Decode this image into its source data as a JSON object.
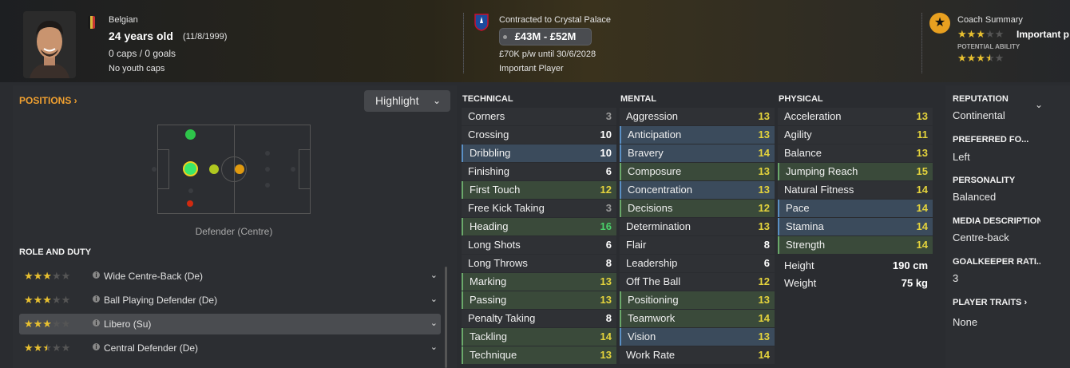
{
  "header": {
    "nationality": "Belgian",
    "age": "24 years old",
    "dob": "(11/8/1999)",
    "caps": "0 caps / 0 goals",
    "youth": "No youth caps",
    "contract": "Contracted to Crystal Palace",
    "value": "£43M - £52M",
    "wage": "£70K p/w until 30/6/2028",
    "status": "Important Player",
    "coach_label": "Coach Summary",
    "coach_rating": "Important p",
    "potential_label": "POTENTIAL ABILITY",
    "current_stars": 3,
    "potential_stars": 3.5
  },
  "positions": {
    "link": "POSITIONS ›",
    "highlight": "Highlight",
    "caption": "Defender (Centre)"
  },
  "role_duty": {
    "title": "ROLE AND DUTY",
    "roles": [
      {
        "name": "Wide Centre-Back (De)",
        "stars": 3
      },
      {
        "name": "Ball Playing Defender (De)",
        "stars": 3
      },
      {
        "name": "Libero (Su)",
        "stars": 3
      },
      {
        "name": "Central Defender (De)",
        "stars": 2.5
      }
    ]
  },
  "technical": {
    "title": "TECHNICAL",
    "items": [
      {
        "name": "Corners",
        "value": "3"
      },
      {
        "name": "Crossing",
        "value": "10"
      },
      {
        "name": "Dribbling",
        "value": "10"
      },
      {
        "name": "Finishing",
        "value": "6"
      },
      {
        "name": "First Touch",
        "value": "12"
      },
      {
        "name": "Free Kick Taking",
        "value": "3"
      },
      {
        "name": "Heading",
        "value": "16"
      },
      {
        "name": "Long Shots",
        "value": "6"
      },
      {
        "name": "Long Throws",
        "value": "8"
      },
      {
        "name": "Marking",
        "value": "13"
      },
      {
        "name": "Passing",
        "value": "13"
      },
      {
        "name": "Penalty Taking",
        "value": "8"
      },
      {
        "name": "Tackling",
        "value": "14"
      },
      {
        "name": "Technique",
        "value": "13"
      }
    ]
  },
  "mental": {
    "title": "MENTAL",
    "items": [
      {
        "name": "Aggression",
        "value": "13"
      },
      {
        "name": "Anticipation",
        "value": "13"
      },
      {
        "name": "Bravery",
        "value": "14"
      },
      {
        "name": "Composure",
        "value": "13"
      },
      {
        "name": "Concentration",
        "value": "13"
      },
      {
        "name": "Decisions",
        "value": "12"
      },
      {
        "name": "Determination",
        "value": "13"
      },
      {
        "name": "Flair",
        "value": "8"
      },
      {
        "name": "Leadership",
        "value": "6"
      },
      {
        "name": "Off The Ball",
        "value": "12"
      },
      {
        "name": "Positioning",
        "value": "13"
      },
      {
        "name": "Teamwork",
        "value": "14"
      },
      {
        "name": "Vision",
        "value": "13"
      },
      {
        "name": "Work Rate",
        "value": "14"
      }
    ]
  },
  "physical": {
    "title": "PHYSICAL",
    "items": [
      {
        "name": "Acceleration",
        "value": "13"
      },
      {
        "name": "Agility",
        "value": "11"
      },
      {
        "name": "Balance",
        "value": "13"
      },
      {
        "name": "Jumping Reach",
        "value": "15"
      },
      {
        "name": "Natural Fitness",
        "value": "14"
      },
      {
        "name": "Pace",
        "value": "14"
      },
      {
        "name": "Stamina",
        "value": "14"
      },
      {
        "name": "Strength",
        "value": "14"
      }
    ],
    "height_label": "Height",
    "height": "190 cm",
    "weight_label": "Weight",
    "weight": "75 kg"
  },
  "side": {
    "reputation_label": "REPUTATION",
    "reputation": "Continental",
    "foot_label": "PREFERRED FO...",
    "foot": "Left",
    "personality_label": "PERSONALITY",
    "personality": "Balanced",
    "media_label": "MEDIA DESCRIPTION",
    "media": "Centre-back",
    "gk_label": "GOALKEEPER RATI...",
    "gk": "3",
    "traits_label": "PLAYER TRAITS ›",
    "traits": "None"
  }
}
